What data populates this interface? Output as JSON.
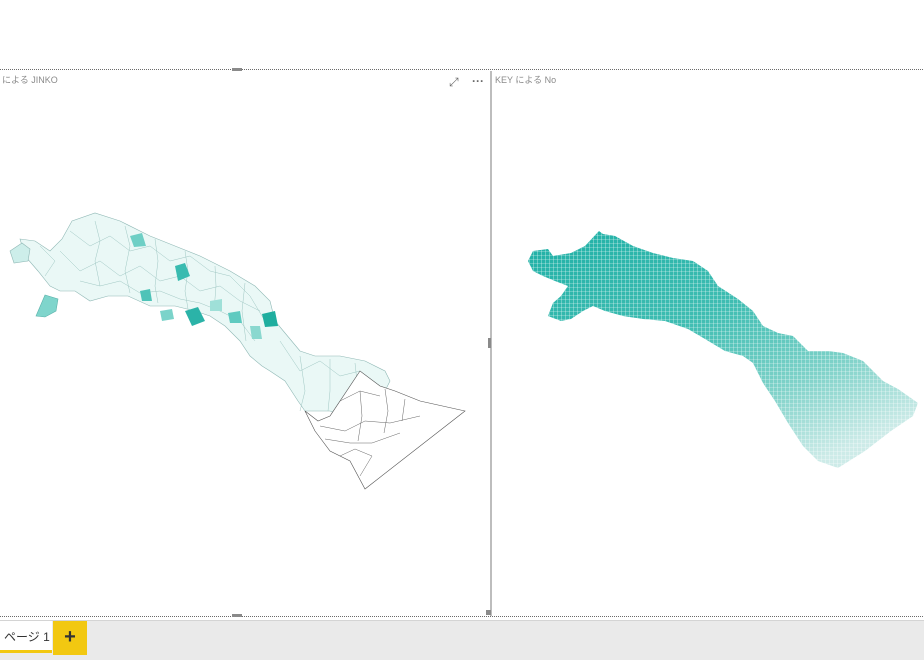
{
  "visuals": {
    "left": {
      "title": "による JINKO"
    },
    "right": {
      "title": "KEY による No"
    }
  },
  "toolbar": {
    "focus_icon": "focus-mode-icon",
    "more_icon": "more-options-icon",
    "more_glyph": "···"
  },
  "pages": {
    "tab_label": "ページ 1",
    "add_glyph": "+"
  },
  "colors": {
    "teal_dark": "#1fb0a6",
    "teal_mid": "#6fd1c8",
    "teal_light": "#d6f3f0",
    "accent": "#f2c811"
  }
}
